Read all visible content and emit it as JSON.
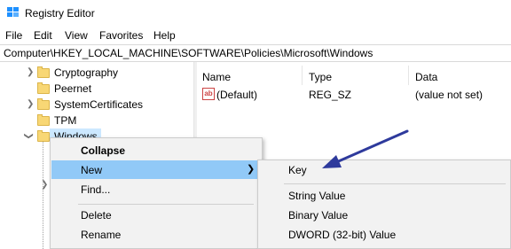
{
  "window": {
    "title": "Registry Editor"
  },
  "menu": [
    "File",
    "Edit",
    "View",
    "Favorites",
    "Help"
  ],
  "address": {
    "path": "Computer\\HKEY_LOCAL_MACHINE\\SOFTWARE\\Policies\\Microsoft\\Windows"
  },
  "tree": {
    "items": [
      {
        "label": "Cryptography"
      },
      {
        "label": "Peernet"
      },
      {
        "label": "SystemCertificates"
      },
      {
        "label": "TPM"
      },
      {
        "label": "Windows"
      }
    ]
  },
  "list": {
    "columns": [
      "Name",
      "Type",
      "Data"
    ],
    "rows": [
      {
        "name": "(Default)",
        "type": "REG_SZ",
        "data": "(value not set)",
        "icon": "ab-string-icon"
      }
    ]
  },
  "context_menu": {
    "items": [
      "Collapse",
      "New",
      "Find...",
      "Delete",
      "Rename"
    ]
  },
  "new_submenu": {
    "items": [
      "Key",
      "String Value",
      "Binary Value",
      "DWORD (32-bit) Value"
    ]
  },
  "colors": {
    "selection": "#cce8ff",
    "menu_highlight": "#91c9f7",
    "arrow": "#2e3a9c",
    "folder": "#f8d775"
  }
}
